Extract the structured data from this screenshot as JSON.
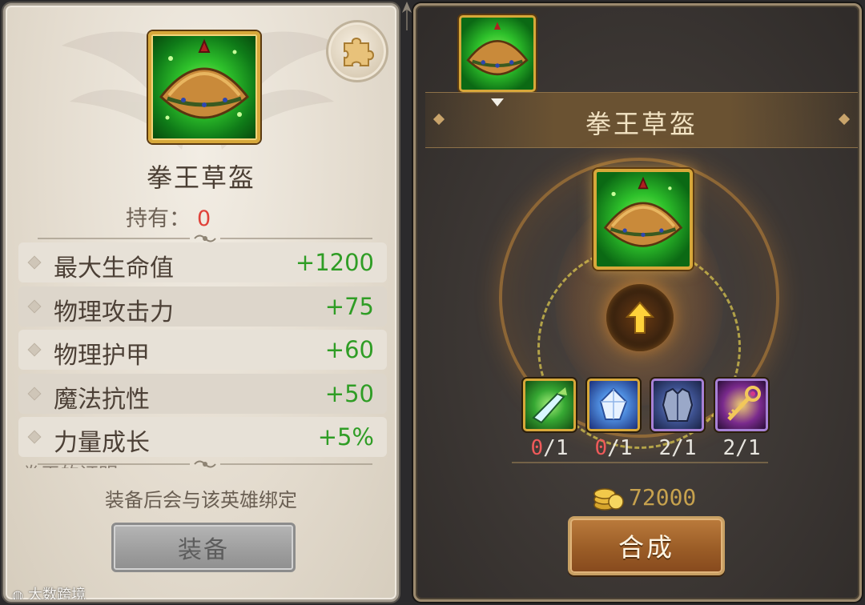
{
  "left": {
    "item_name": "拳王草盔",
    "owned_label": "持有：",
    "owned_value": "0",
    "stats": [
      {
        "label": "最大生命值",
        "value": "+1200"
      },
      {
        "label": "物理攻击力",
        "value": "+75"
      },
      {
        "label": "物理护甲",
        "value": "+60"
      },
      {
        "label": "魔法抗性",
        "value": "+50"
      },
      {
        "label": "力量成长",
        "value": "+5%"
      }
    ],
    "cut_text": "拳王的证明",
    "bind_note": "装备后会与该英雄绑定",
    "equip_button": "装备",
    "watermark": "大数跨境"
  },
  "right": {
    "title": "拳王草盔",
    "materials": [
      {
        "icon": "green-blade-icon",
        "have": "0",
        "need": "1"
      },
      {
        "icon": "blue-crystal-icon",
        "have": "0",
        "need": "1"
      },
      {
        "icon": "armor-icon",
        "have": "2",
        "need": "1"
      },
      {
        "icon": "key-scepter-icon",
        "have": "2",
        "need": "1"
      }
    ],
    "gold_cost": "72000",
    "craft_button": "合成"
  },
  "colors": {
    "stat_value": "#2f9d25",
    "owned_zero": "#e0423a",
    "missing_count": "#f05a5a",
    "gold": "#c7a24e"
  }
}
